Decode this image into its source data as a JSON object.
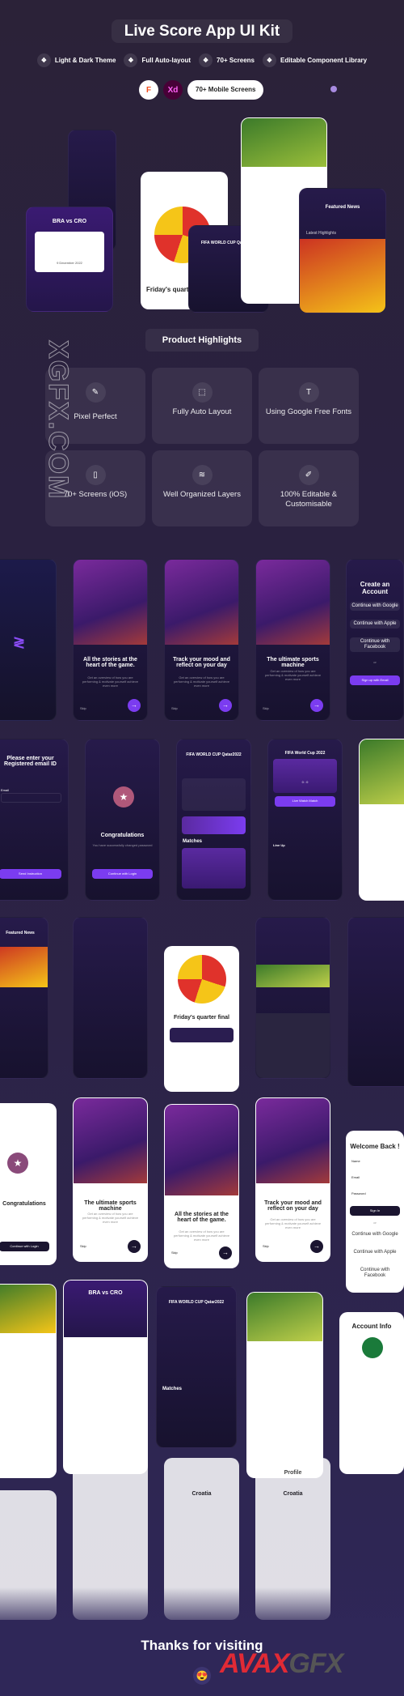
{
  "header": {
    "title": "Live Score App UI Kit",
    "features": [
      "Light & Dark Theme",
      "Full Auto-layout",
      "70+ Screens",
      "Editable Component Library"
    ],
    "tools": {
      "figma": "F",
      "xd": "Xd"
    },
    "screens_badge": "70+ Mobile Screens"
  },
  "hero": {
    "match_title": "BRA vs CRO",
    "date": "9 December 2022",
    "cup": "FIFA WORLD CUP Qatar2022",
    "final": "Friday's quarter final",
    "featured": "Featured News",
    "latest": "Latest Highlights"
  },
  "highlights": {
    "title": "Product Highlights",
    "items": [
      {
        "icon": "pen-tool-icon",
        "label": "Pixel Perfect"
      },
      {
        "icon": "auto-layout-icon",
        "label": "Fully Auto Layout"
      },
      {
        "icon": "type-icon",
        "label": "Using Google Free Fonts"
      },
      {
        "icon": "phone-icon",
        "label": "70+ Screens (iOS)"
      },
      {
        "icon": "layers-icon",
        "label": "Well Organized Layers"
      },
      {
        "icon": "edit-icon",
        "label": "100% Editable & Customisable"
      }
    ]
  },
  "screens": {
    "onboard1": "All the stories at the heart of the game.",
    "onboard2": "Track your mood and reflect on your day",
    "onboard3": "The ultimate sports machine",
    "onboard_sub": "Get an overview of how you are performing & motivate yourself achieve even more",
    "skip": "Skip",
    "create_account": "Create an Account",
    "continue_google": "Continue with Google",
    "continue_apple": "Continue with Apple",
    "continue_facebook": "Continue with Facebook",
    "or": "or",
    "signup_email": "Sign up with Email",
    "forgot_title": "Please enter your Registered email ID",
    "email_label": "Email",
    "send_instruction": "Send Instruction",
    "congrats": "Congratulations",
    "congrats_sub": "You have successfully changed password",
    "continue_login": "Continue with Login",
    "matches": "Matches",
    "world_cup": "FIFA World Cup 2022",
    "live_watch": "Live Watch Match",
    "line_up": "Line Up",
    "score": "0 : 0",
    "welcome_back": "Welcome Back !",
    "name": "Name",
    "password": "Password",
    "sign_in": "Sign In",
    "account_info": "Account Info",
    "croatia": "Croatia",
    "profile": "Profile"
  },
  "footer": {
    "thanks": "Thanks for visiting",
    "emoji": "😍"
  },
  "watermark": {
    "text": "AVAXGFX.COM",
    "logo": "AVAXGFX"
  },
  "colors": {
    "accent": "#7b3cf0",
    "bg": "#2b2238",
    "brand_red": "#e02a35"
  }
}
